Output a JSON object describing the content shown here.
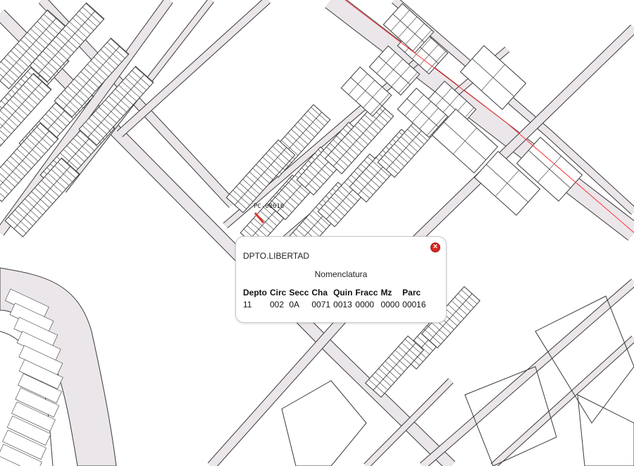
{
  "map": {
    "colors": {
      "road": "#ebe6ea",
      "line": "#3a3a3a",
      "rail": "#ff3333",
      "selected": "#e03a2e"
    },
    "parcel_label": "PC-00016"
  },
  "popup": {
    "title": "DPTO.LIBERTAD",
    "subtitle": "Nomenclatura",
    "close_icon": "close-icon",
    "columns": [
      "Depto",
      "Circ",
      "Secc",
      "Cha",
      "Quin",
      "Fracc",
      "Mz",
      "Parc"
    ],
    "row": [
      "11",
      "002",
      "0A",
      "0071",
      "0013",
      "0000",
      "0000",
      "00016"
    ]
  }
}
